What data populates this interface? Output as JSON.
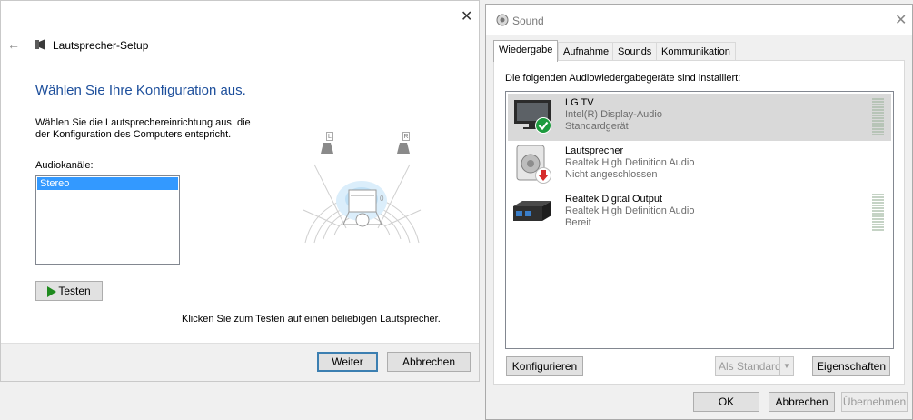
{
  "setup": {
    "title": "Lautsprecher-Setup",
    "heading": "Wählen Sie Ihre Konfiguration aus.",
    "description_line1": "Wählen Sie die Lautsprechereinrichtung aus, die",
    "description_line2": "der Konfiguration des Computers entspricht.",
    "channels_label": "Audiokanäle:",
    "channels_options": [
      "Stereo"
    ],
    "selected_channel": "Stereo",
    "test_button": "Testen",
    "hint": "Klicken Sie zum Testen auf einen beliebigen Lautsprecher.",
    "speaker_left_label": "L",
    "speaker_right_label": "R",
    "next_button": "Weiter",
    "cancel_button": "Abbrechen"
  },
  "sound": {
    "title": "Sound",
    "tabs": [
      "Wiedergabe",
      "Aufnahme",
      "Sounds",
      "Kommunikation"
    ],
    "active_tab": "Wiedergabe",
    "intro": "Die folgenden Audiowiedergabegeräte sind installiert:",
    "devices": [
      {
        "name": "LG TV",
        "driver": "Intel(R) Display-Audio",
        "status": "Standardgerät",
        "icon": "tv-icon",
        "badge": "default-check-icon",
        "selected": true
      },
      {
        "name": "Lautsprecher",
        "driver": "Realtek High Definition Audio",
        "status": "Nicht angeschlossen",
        "icon": "speaker-icon",
        "badge": "unplugged-arrow-icon",
        "selected": false
      },
      {
        "name": "Realtek Digital Output",
        "driver": "Realtek High Definition Audio",
        "status": "Bereit",
        "icon": "digital-output-icon",
        "badge": "",
        "selected": false
      }
    ],
    "configure_button": "Konfigurieren",
    "set_default_button": "Als Standard",
    "properties_button": "Eigenschaften",
    "ok_button": "OK",
    "cancel_button": "Abbrechen",
    "apply_button": "Übernehmen"
  },
  "colors": {
    "heading_blue": "#1c4e9b",
    "selection_blue": "#3399ff",
    "default_check_green": "#1d9a3e",
    "unplugged_red": "#d62b2b",
    "play_green": "#1e8a1e"
  }
}
